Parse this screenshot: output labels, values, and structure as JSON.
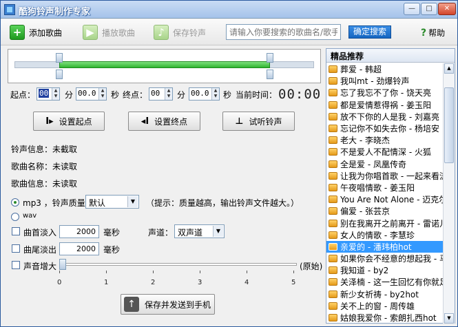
{
  "window": {
    "title": "酷狗铃声制作专家",
    "min": "—",
    "max": "□",
    "close": "✕"
  },
  "toolbar": {
    "add_label": "添加歌曲",
    "play_label": "播放歌曲",
    "save_label": "保存铃声",
    "search_placeholder": "请输入你要搜索的歌曲名/歌手",
    "search_button": "确定搜索",
    "help_label": "帮助"
  },
  "trim": {
    "start_label": "起点：",
    "start_min": "00",
    "start_sec": "00.0",
    "min_unit": "分",
    "sec_unit": "秒",
    "end_label": "终点：",
    "end_min": "00",
    "end_sec": "00.0",
    "current_time_label": "当前时间：",
    "current_time": "00:00"
  },
  "buttons": {
    "set_start": "设置起点",
    "set_end": "设置终点",
    "preview": "试听铃声"
  },
  "info": {
    "ringtone_info": "铃声信息：未截取",
    "song_name": "歌曲名称：未读取",
    "song_info": "歌曲信息：未读取"
  },
  "format": {
    "mp3_label": "mp3 ，铃声质量：",
    "quality": "默认",
    "hint": "（提示：质量越高，输出铃声文件越大。）",
    "wav_label": "wav"
  },
  "effects": {
    "fade_in_label": "曲首淡入",
    "fade_in_value": "2000",
    "fade_out_label": "曲尾淡出",
    "fade_out_value": "2000",
    "ms_unit": "毫秒",
    "channel_label": "声道：",
    "channel_value": "双声道",
    "volume_label": "声音增大",
    "volume_original": "(原始)",
    "volume_ticks": [
      "0",
      "1",
      "2",
      "3",
      "4",
      "5"
    ]
  },
  "send_button": "保存并发送到手机",
  "recommend": {
    "header": "精品推荐",
    "items": [
      "葬爱 - 韩超",
      "我叫mt - 劲爆铃声",
      "忘了我忘不了你 - 饶天亮",
      "都是爱情惹得祸 - 姜玉阳",
      "放不下你的人是我 - 刘嘉亮",
      "忘记你不如失去你 - 杨培安",
      "老大 - 李晓杰",
      "不是爱人不配情深 - 火狐",
      "全是爱 - 凤凰传奇",
      "让我为你唱首歌 - 一起来看流星雨",
      "午夜唱情歌 - 姜玉阳",
      "You Are Not Alone - 迈克尔",
      "偏爱 - 张芸京",
      "别在我离开之前离开 - 雷诺儿",
      "女人的情歌 - 李慧珍",
      "亲爱的 - 潘玮柏hot",
      "如果你会不经意的想起我 - 马",
      "我知道 - by2",
      "关泽楠 - 这一生回忆有你就足够",
      "新少女祈祷 - by2hot",
      "关不上的窗 - 周传雄",
      "姑娘我爱你 - 索朗扎西hot"
    ]
  }
}
